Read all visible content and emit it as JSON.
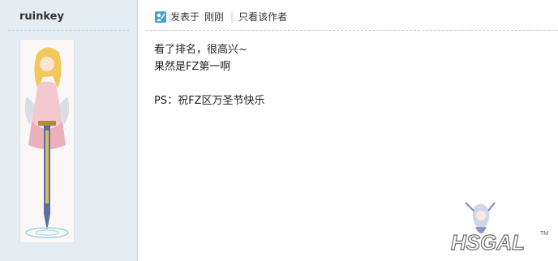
{
  "author": {
    "name": "ruinkey"
  },
  "post_meta": {
    "posted_label": "发表于",
    "time": "刚刚",
    "separator": "|",
    "only_author_label": "只看该作者"
  },
  "content": {
    "line1": "看了排名，很高兴~",
    "line2": "果然是FZ第一啊",
    "line3": "PS：祝FZ区万圣节快乐"
  },
  "watermark": {
    "text": "HSGAL",
    "tm": "TM"
  },
  "colors": {
    "sidebar_bg": "#e5edf2",
    "border": "#c2d5e3",
    "link": "#333333"
  },
  "icons": {
    "post_icon": "post-icon",
    "avatar": "anime-character-avatar"
  }
}
